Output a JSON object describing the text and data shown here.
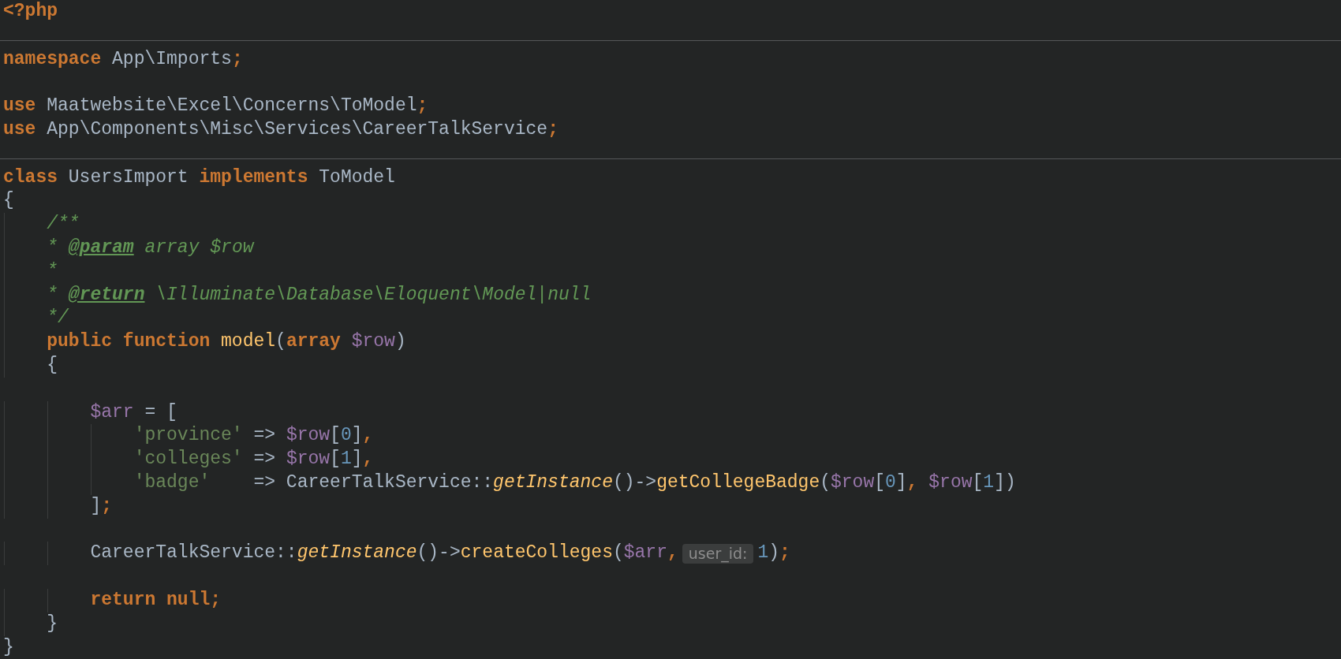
{
  "editor": {
    "lines": [
      {
        "kind": "code",
        "tokens": [
          {
            "text": "<?php",
            "kind": "keyword"
          }
        ]
      },
      {
        "kind": "blank"
      },
      {
        "kind": "divider"
      },
      {
        "kind": "code",
        "tokens": [
          {
            "text": "namespace",
            "kind": "keyword"
          },
          {
            "text": " App\\Imports",
            "kind": "plain"
          },
          {
            "text": ";",
            "kind": "punct"
          }
        ]
      },
      {
        "kind": "blank"
      },
      {
        "kind": "code",
        "tokens": [
          {
            "text": "use",
            "kind": "keyword"
          },
          {
            "text": " Maatwebsite\\Excel\\Concerns\\ToModel",
            "kind": "plain"
          },
          {
            "text": ";",
            "kind": "punct"
          }
        ]
      },
      {
        "kind": "code",
        "tokens": [
          {
            "text": "use",
            "kind": "keyword"
          },
          {
            "text": " App\\Components\\Misc\\Services\\CareerTalkService",
            "kind": "plain"
          },
          {
            "text": ";",
            "kind": "punct"
          }
        ]
      },
      {
        "kind": "blank"
      },
      {
        "kind": "divider"
      },
      {
        "kind": "code",
        "tokens": [
          {
            "text": "class",
            "kind": "keyword"
          },
          {
            "text": " UsersImport ",
            "kind": "plain"
          },
          {
            "text": "implements",
            "kind": "keyword"
          },
          {
            "text": " ToModel",
            "kind": "plain"
          }
        ]
      },
      {
        "kind": "code",
        "tokens": [
          {
            "text": "{",
            "kind": "plain"
          }
        ]
      },
      {
        "kind": "code",
        "tokens": [
          {
            "text": "    /**",
            "kind": "doc"
          }
        ]
      },
      {
        "kind": "code",
        "tokens": [
          {
            "text": "    * ",
            "kind": "doc"
          },
          {
            "text": "@param",
            "kind": "doctag"
          },
          {
            "text": " array $row",
            "kind": "doc"
          }
        ]
      },
      {
        "kind": "code",
        "tokens": [
          {
            "text": "    *",
            "kind": "doc"
          }
        ]
      },
      {
        "kind": "code",
        "tokens": [
          {
            "text": "    * ",
            "kind": "doc"
          },
          {
            "text": "@return",
            "kind": "doctag"
          },
          {
            "text": " \\Illuminate\\Database\\Eloquent\\Model|null",
            "kind": "doc"
          }
        ]
      },
      {
        "kind": "code",
        "tokens": [
          {
            "text": "    */",
            "kind": "doc"
          }
        ]
      },
      {
        "kind": "code",
        "tokens": [
          {
            "text": "    public function ",
            "kind": "keyword"
          },
          {
            "text": "model",
            "kind": "function"
          },
          {
            "text": "(",
            "kind": "plain"
          },
          {
            "text": "array ",
            "kind": "keyword"
          },
          {
            "text": "$row",
            "kind": "variable"
          },
          {
            "text": ")",
            "kind": "plain"
          }
        ]
      },
      {
        "kind": "code",
        "tokens": [
          {
            "text": "    {",
            "kind": "plain"
          }
        ]
      },
      {
        "kind": "blank"
      },
      {
        "kind": "code",
        "tokens": [
          {
            "text": "        $arr",
            "kind": "variable"
          },
          {
            "text": " = [",
            "kind": "plain"
          }
        ]
      },
      {
        "kind": "code",
        "tokens": [
          {
            "text": "            'province'",
            "kind": "string"
          },
          {
            "text": " => ",
            "kind": "plain"
          },
          {
            "text": "$row",
            "kind": "variable"
          },
          {
            "text": "[",
            "kind": "plain"
          },
          {
            "text": "0",
            "kind": "number"
          },
          {
            "text": "]",
            "kind": "plain"
          },
          {
            "text": ",",
            "kind": "punct"
          }
        ]
      },
      {
        "kind": "code",
        "tokens": [
          {
            "text": "            'colleges'",
            "kind": "string"
          },
          {
            "text": " => ",
            "kind": "plain"
          },
          {
            "text": "$row",
            "kind": "variable"
          },
          {
            "text": "[",
            "kind": "plain"
          },
          {
            "text": "1",
            "kind": "number"
          },
          {
            "text": "]",
            "kind": "plain"
          },
          {
            "text": ",",
            "kind": "punct"
          }
        ]
      },
      {
        "kind": "code",
        "tokens": [
          {
            "text": "            'badge'",
            "kind": "string"
          },
          {
            "text": "    => CareerTalkService::",
            "kind": "plain"
          },
          {
            "text": "getInstance",
            "kind": "static"
          },
          {
            "text": "()->",
            "kind": "plain"
          },
          {
            "text": "getCollegeBadge",
            "kind": "function"
          },
          {
            "text": "(",
            "kind": "plain"
          },
          {
            "text": "$row",
            "kind": "variable"
          },
          {
            "text": "[",
            "kind": "plain"
          },
          {
            "text": "0",
            "kind": "number"
          },
          {
            "text": "]",
            "kind": "plain"
          },
          {
            "text": ", ",
            "kind": "punct"
          },
          {
            "text": "$row",
            "kind": "variable"
          },
          {
            "text": "[",
            "kind": "plain"
          },
          {
            "text": "1",
            "kind": "number"
          },
          {
            "text": "])",
            "kind": "plain"
          }
        ]
      },
      {
        "kind": "code",
        "tokens": [
          {
            "text": "        ]",
            "kind": "plain"
          },
          {
            "text": ";",
            "kind": "punct"
          }
        ]
      },
      {
        "kind": "blank"
      },
      {
        "kind": "code",
        "tokens": [
          {
            "text": "        CareerTalkService::",
            "kind": "plain"
          },
          {
            "text": "getInstance",
            "kind": "static"
          },
          {
            "text": "()->",
            "kind": "plain"
          },
          {
            "text": "createColleges",
            "kind": "function"
          },
          {
            "text": "(",
            "kind": "plain"
          },
          {
            "text": "$arr",
            "kind": "variable"
          },
          {
            "text": ",",
            "kind": "punct"
          },
          {
            "text": "user_id:",
            "kind": "hint"
          },
          {
            "text": "1",
            "kind": "number"
          },
          {
            "text": ")",
            "kind": "plain"
          },
          {
            "text": ";",
            "kind": "punct"
          }
        ]
      },
      {
        "kind": "blank"
      },
      {
        "kind": "code",
        "tokens": [
          {
            "text": "        return null",
            "kind": "keyword"
          },
          {
            "text": ";",
            "kind": "punct"
          }
        ]
      },
      {
        "kind": "code",
        "tokens": [
          {
            "text": "    }",
            "kind": "plain"
          }
        ]
      },
      {
        "kind": "code",
        "tokens": [
          {
            "text": "}",
            "kind": "plain"
          }
        ]
      }
    ]
  }
}
